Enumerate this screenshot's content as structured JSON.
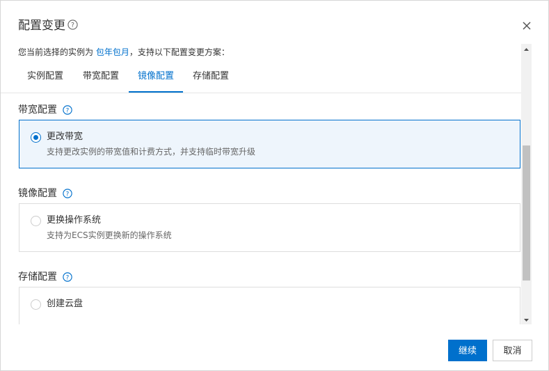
{
  "dialog": {
    "title": "配置变更",
    "close_icon": "close-icon",
    "help_icon": "help-circle-icon"
  },
  "intro": {
    "prefix": "您当前选择的实例为 ",
    "billing_link": "包年包月",
    "suffix": "，支持以下配置变更方案："
  },
  "tabs": [
    {
      "label": "实例配置",
      "active": false
    },
    {
      "label": "带宽配置",
      "active": false
    },
    {
      "label": "镜像配置",
      "active": true
    },
    {
      "label": "存储配置",
      "active": false
    }
  ],
  "sections": [
    {
      "title": "带宽配置",
      "option": {
        "label": "更改带宽",
        "description": "支持更改实例的带宽值和计费方式，并支持临时带宽升级",
        "selected": true
      }
    },
    {
      "title": "镜像配置",
      "option": {
        "label": "更换操作系统",
        "description": "支持为ECS实例更换新的操作系统",
        "selected": false
      }
    },
    {
      "title": "存储配置",
      "option": {
        "label": "创建云盘",
        "description": "",
        "selected": false
      }
    }
  ],
  "footer": {
    "continue_label": "继续",
    "cancel_label": "取消"
  },
  "colors": {
    "accent": "#0070cc",
    "selected_bg": "#eef5fc",
    "border": "#dddddd"
  }
}
